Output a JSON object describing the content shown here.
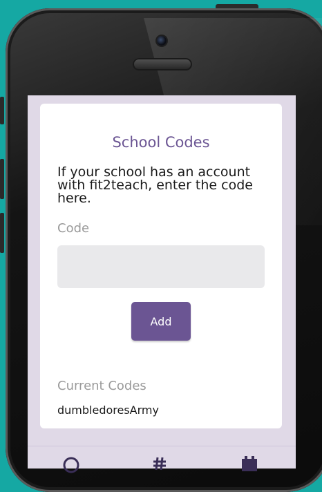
{
  "page": {
    "title": "School Codes",
    "description": "If your school has an account with fit2teach, enter the code here.",
    "code_label": "Code",
    "code_input": {
      "value": "",
      "placeholder": ""
    },
    "add_button_label": "Add",
    "current_codes_label": "Current Codes",
    "current_codes": [
      "dumbledoresArmy"
    ]
  },
  "tabbar": {
    "icons": [
      "circle-icon",
      "hash-icon",
      "calendar-icon"
    ]
  },
  "colors": {
    "background": "#15a8a3",
    "accent": "#6b5593",
    "screen": "#e0d9e7",
    "input": "#e9e9eb"
  }
}
